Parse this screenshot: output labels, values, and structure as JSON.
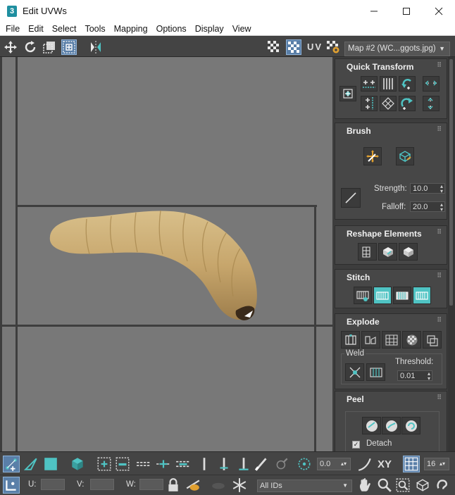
{
  "window": {
    "title": "Edit UVWs",
    "app_icon": "3"
  },
  "menu": [
    "File",
    "Edit",
    "Select",
    "Tools",
    "Mapping",
    "Options",
    "Display",
    "View"
  ],
  "toolbar": {
    "uv_label": "UV",
    "map_select": "Map #2 (WC...ggots.jpg)"
  },
  "panel": {
    "quick_transform": {
      "title": "Quick Transform"
    },
    "brush": {
      "title": "Brush",
      "strength_label": "Strength:",
      "strength_value": "10.0",
      "falloff_label": "Falloff:",
      "falloff_value": "20.0"
    },
    "reshape": {
      "title": "Reshape Elements"
    },
    "stitch": {
      "title": "Stitch"
    },
    "explode": {
      "title": "Explode",
      "weld_label": "Weld",
      "threshold_label": "Threshold:",
      "threshold_value": "0.01"
    },
    "peel": {
      "title": "Peel",
      "detach_label": "Detach",
      "detach_checked": true
    }
  },
  "bottom": {
    "angle_value": "0.0",
    "xy_label": "XY",
    "grid_value": "16",
    "u_label": "U:",
    "v_label": "V:",
    "w_label": "W:",
    "ids_select": "All IDs"
  },
  "colors": {
    "accent": "#4fc3c3",
    "viewport": "#787878",
    "panel": "#474747"
  }
}
